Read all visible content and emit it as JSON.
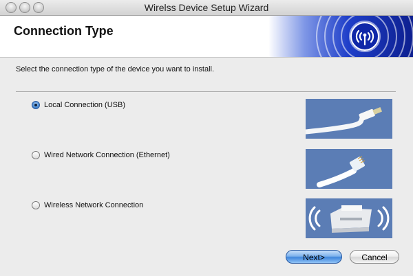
{
  "window": {
    "title": "Wirelss Device Setup Wizard"
  },
  "header": {
    "title": "Connection Type",
    "banner_icon": "wireless-logo-icon"
  },
  "instruction": "Select the connection type of the device you want to install.",
  "options": [
    {
      "label": "Local Connection (USB)",
      "selected": true,
      "image": "usb-cable-image"
    },
    {
      "label": "Wired Network Connection (Ethernet)",
      "selected": false,
      "image": "ethernet-cable-image"
    },
    {
      "label": "Wireless Network Connection",
      "selected": false,
      "image": "wireless-printer-image"
    }
  ],
  "buttons": {
    "next": "Next>",
    "cancel": "Cancel"
  },
  "colors": {
    "accent": "#3f86dc",
    "thumb_bg": "#5b7db5",
    "banner_blue": "#1f3fc9"
  }
}
